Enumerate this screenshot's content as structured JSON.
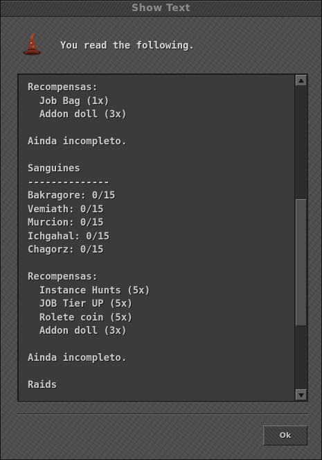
{
  "window": {
    "title": "Show Text"
  },
  "header": {
    "icon": "wizard-hat-icon",
    "text": "You read the following."
  },
  "content": {
    "lines": [
      "Recompensas:",
      "  Job Bag (1x)",
      "  Addon doll (3x)",
      "",
      "Ainda incompleto.",
      "",
      "Sanguines",
      "--------------",
      "Bakragore: 0/15",
      "Vemiath: 0/15",
      "Murcion: 0/15",
      "Ichgahal: 0/15",
      "Chagorz: 0/15",
      "",
      "Recompensas:",
      "  Instance Hunts (5x)",
      "  JOB Tier UP (5x)",
      "  Rolete coin (5x)",
      "  Addon doll (3x)",
      "",
      "Ainda incompleto.",
      "",
      "Raids"
    ]
  },
  "scrollbar": {
    "up_icon": "arrow-up-icon",
    "down_icon": "arrow-down-icon"
  },
  "footer": {
    "ok_label": "Ok"
  }
}
